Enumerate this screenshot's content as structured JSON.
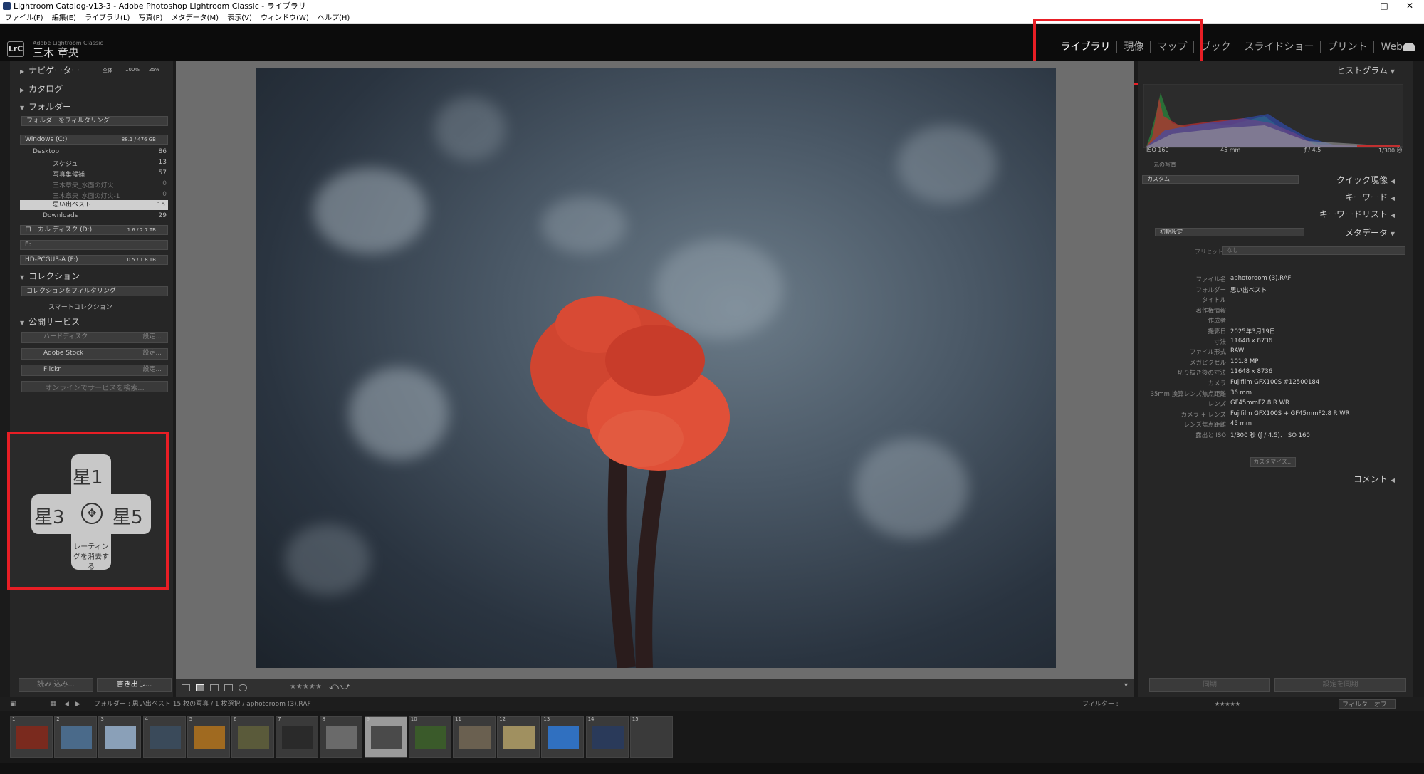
{
  "window": {
    "title": "Lightroom Catalog-v13-3 - Adobe Photoshop Lightroom Classic - ライブラリ",
    "minimize": "–",
    "maximize": "□",
    "close": "✕"
  },
  "menu": [
    "ファイル(F)",
    "編集(E)",
    "ライブラリ(L)",
    "写真(P)",
    "メタデータ(M)",
    "表示(V)",
    "ウィンドウ(W)",
    "ヘルプ(H)"
  ],
  "identity": {
    "logo": "LrC",
    "app": "Adobe Lightroom Classic",
    "user": "三木 章央"
  },
  "modules": [
    "ライブラリ",
    "現像",
    "マップ",
    "ブック",
    "スライドショー",
    "プリント",
    "Web"
  ],
  "left": {
    "navigator": {
      "label": "ナビゲーター",
      "zoom": [
        "全体",
        "100%",
        "25%"
      ]
    },
    "catalog": "カタログ",
    "folders": {
      "label": "フォルダー",
      "filter": "フォルダーをフィルタリング",
      "volumes": [
        {
          "name": "Windows (C:)",
          "size": "88.1 / 476 GB"
        },
        {
          "name": "ローカル ディスク (D:)",
          "size": "1.6 / 2.7 TB"
        },
        {
          "name": "E:",
          "size": ""
        },
        {
          "name": "HD-PCGU3-A (F:)",
          "size": "0.5 / 1.8 TB"
        }
      ],
      "items": [
        {
          "name": "Desktop",
          "count": "86"
        },
        {
          "name": "スケジュ",
          "count": "13"
        },
        {
          "name": "写真集候補",
          "count": "57"
        },
        {
          "name": "三木章央_水面の灯火",
          "count": "0"
        },
        {
          "name": "三木章央_水面の灯火-1",
          "count": "0"
        },
        {
          "name": "思い出ベスト",
          "count": "15"
        },
        {
          "name": "Downloads",
          "count": "29"
        }
      ]
    },
    "collections": {
      "label": "コレクション",
      "filter": "コレクションをフィルタリング",
      "smart": "スマートコレクション"
    },
    "publish": {
      "label": "公開サービス",
      "services": [
        {
          "name": "ハードディスク",
          "action": "設定..."
        },
        {
          "name": "Adobe Stock",
          "action": "設定..."
        },
        {
          "name": "Flickr",
          "action": "設定..."
        }
      ],
      "find": "オンラインでサービスを検索..."
    },
    "import": "読み 込み...",
    "export": "書き出し..."
  },
  "rating_overlay": {
    "top": "星1",
    "left": "星3",
    "right": "星5",
    "bottom": "レーティングを消去する",
    "center": "✥"
  },
  "right": {
    "histogram": {
      "label": "ヒストグラム",
      "iso": "ISO 160",
      "focal": "45 mm",
      "aperture": "ƒ / 4.5",
      "shutter": "1/300 秒",
      "original": "元の写真"
    },
    "quick": {
      "label": "クイック現像",
      "preset": "カスタム"
    },
    "keyword": "キーワード",
    "keyword_list": "キーワードリスト",
    "metadata": {
      "label": "メタデータ",
      "preset": "初期設定",
      "preset_label": "プリセット",
      "preset_val": "なし",
      "fields": [
        {
          "k": "ファイル名",
          "v": "aphotoroom (3).RAF"
        },
        {
          "k": "フォルダー",
          "v": "思い出ベスト"
        },
        {
          "k": "タイトル",
          "v": ""
        },
        {
          "k": "著作権情報",
          "v": ""
        },
        {
          "k": "作成者",
          "v": ""
        },
        {
          "k": "撮影日",
          "v": "2025年3月19日"
        },
        {
          "k": "寸法",
          "v": "11648 x 8736"
        },
        {
          "k": "ファイル形式",
          "v": "RAW"
        },
        {
          "k": "メガピクセル",
          "v": "101.8 MP"
        },
        {
          "k": "切り抜き後の寸法",
          "v": "11648 x 8736"
        },
        {
          "k": "カメラ",
          "v": "Fujifilm GFX100S #12500184"
        },
        {
          "k": "35mm 換算レンズ焦点距離",
          "v": "36 mm"
        },
        {
          "k": "レンズ",
          "v": "GF45mmF2.8 R WR"
        },
        {
          "k": "カメラ + レンズ",
          "v": "Fujifilm GFX100S + GF45mmF2.8 R WR"
        },
        {
          "k": "レンズ焦点距離",
          "v": "45 mm"
        },
        {
          "k": "露出と ISO",
          "v": "1/300 秒 (ƒ / 4.5)、ISO 160"
        }
      ],
      "customize": "カスタマイズ..."
    },
    "comment": "コメント",
    "sync": "同期",
    "sync_settings": "設定を同期"
  },
  "filmbar": {
    "source": "フォルダー : 思い出ベスト  15 枚の写真 / 1 枚選択 / aphotoroom (3).RAF",
    "filter_label": "フィルター :",
    "filter_off": "フィルターオフ"
  },
  "thumbs": [
    "1",
    "2",
    "3",
    "4",
    "5",
    "6",
    "7",
    "8",
    "9",
    "10",
    "11",
    "12",
    "13",
    "14",
    "15"
  ],
  "thumb_colors": [
    "#7a2a1e",
    "#4a6a8a",
    "#8aa0b8",
    "#3a4a5a",
    "#a06a20",
    "#5a5a3a",
    "#2a2a2a",
    "#6a6a6a",
    "#4a4a4a",
    "#3a5a2a",
    "#6a6050",
    "#a09060",
    "#3070c0",
    "#2a3a5a",
    "#3a3a3a"
  ],
  "accent": "#e81e25"
}
